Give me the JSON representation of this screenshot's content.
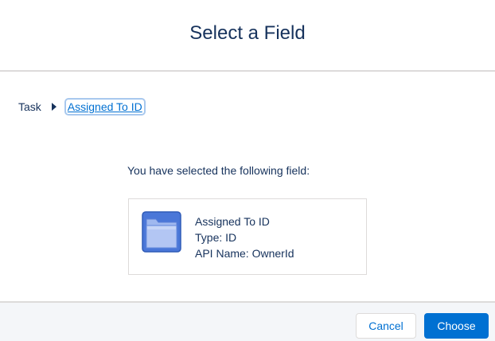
{
  "modal": {
    "title": "Select a Field"
  },
  "breadcrumb": {
    "root": "Task",
    "current": "Assigned To ID"
  },
  "selection": {
    "message": "You have selected the following field:",
    "field_label": "Assigned To ID",
    "type_line": "Type: ID",
    "api_line": "API Name: OwnerId",
    "icon": "folder-icon"
  },
  "footer": {
    "cancel_label": "Cancel",
    "choose_label": "Choose"
  },
  "colors": {
    "accent": "#0070d2",
    "text": "#16325c",
    "border": "#dddbda",
    "footer_bg": "#f4f6f9"
  }
}
